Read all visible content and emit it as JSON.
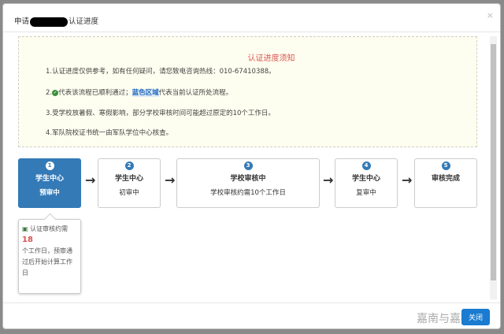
{
  "dialog": {
    "title_prefix": "申请",
    "title_suffix": "认证进度",
    "close_x": "×"
  },
  "notice": {
    "title": "认证进度须知",
    "line1": "1.认证进度仅供参考，如有任何疑问，请您致电咨询热线：010-67410388。",
    "line2_prefix": "2.",
    "line2_a": "代表该流程已顺利通过；",
    "line2_blue": "蓝色区域",
    "line2_b": "代表当前认证所处流程。",
    "line3": "3.受学校放暑假、寒假影响，部分学校审核时间可能超过原定的10个工作日。",
    "line4": "4.军队院校证书统一由军队学位中心核查。"
  },
  "steps": [
    {
      "num": "1",
      "title": "学生中心",
      "sub": "预审中",
      "active": true
    },
    {
      "num": "2",
      "title": "学生中心",
      "sub": "初审中"
    },
    {
      "num": "3",
      "title": "学校审核中",
      "sub": "学校审核约需10个工作日"
    },
    {
      "num": "4",
      "title": "学生中心",
      "sub": "复审中"
    },
    {
      "num": "5",
      "title": "审核完成",
      "sub": ""
    }
  ],
  "tooltip": {
    "a": "认证审核约需",
    "days": "18",
    "b": "个工作日，预审通过后开始计算工作日"
  },
  "footer": {
    "watermark": "嘉南与嘉祺",
    "close_label": "关闭"
  }
}
